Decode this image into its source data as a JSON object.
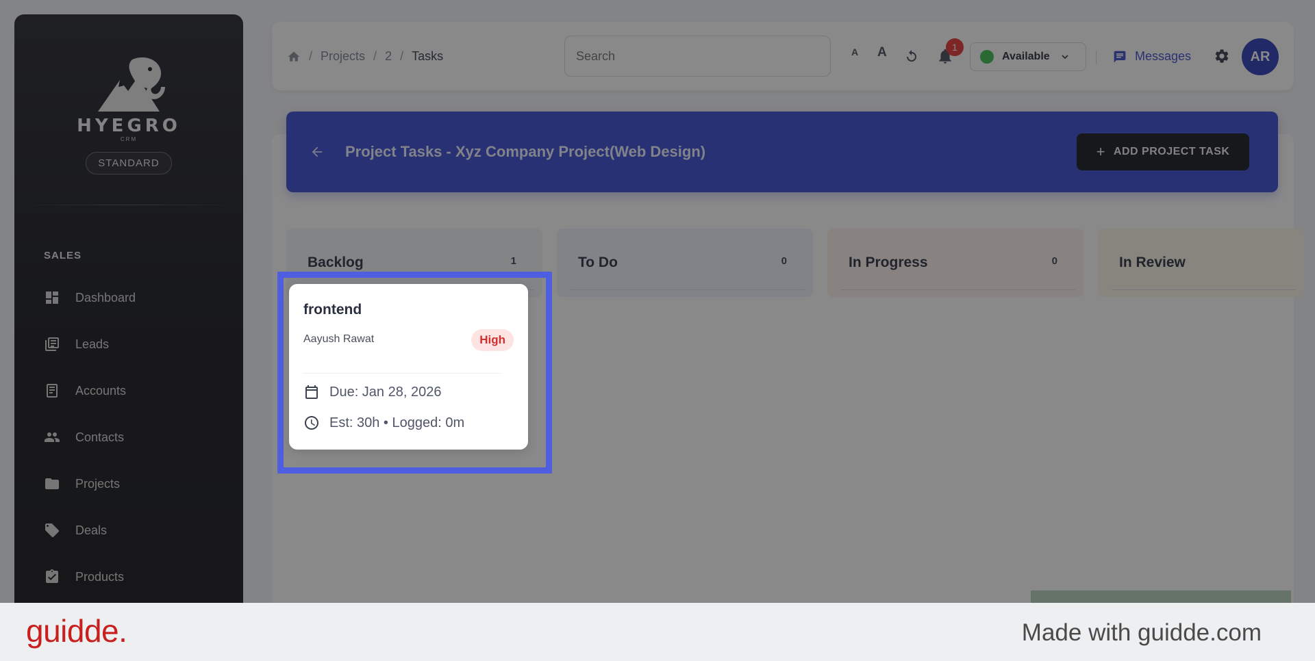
{
  "sidebar": {
    "brand": "HYEGRO",
    "brand_sub": "CRM",
    "plan": "STANDARD",
    "section": "SALES",
    "items": [
      {
        "label": "Dashboard",
        "icon": "dashboard-icon"
      },
      {
        "label": "Leads",
        "icon": "leads-icon"
      },
      {
        "label": "Accounts",
        "icon": "accounts-icon"
      },
      {
        "label": "Contacts",
        "icon": "contacts-icon"
      },
      {
        "label": "Projects",
        "icon": "folder-icon"
      },
      {
        "label": "Deals",
        "icon": "tag-icon"
      },
      {
        "label": "Products",
        "icon": "clipboard-icon"
      }
    ]
  },
  "topbar": {
    "breadcrumb": [
      "Projects",
      "2",
      "Tasks"
    ],
    "search_placeholder": "Search",
    "font_small": "A",
    "font_large": "A",
    "notifications_count": "1",
    "status": "Available",
    "status_color": "#3cbf52",
    "messages": "Messages",
    "avatar_initials": "AR"
  },
  "header": {
    "title": "Project Tasks - Xyz Company Project(Web Design)",
    "add_button": "ADD PROJECT TASK"
  },
  "columns": [
    {
      "title": "Backlog",
      "count": "1"
    },
    {
      "title": "To Do",
      "count": "0"
    },
    {
      "title": "In Progress",
      "count": "0"
    },
    {
      "title": "In Review",
      "count": ""
    }
  ],
  "card": {
    "title": "frontend",
    "assignee": "Aayush Rawat",
    "priority": "High",
    "due": "Due: Jan 28, 2026",
    "estimate": "Est: 30h • Logged: 0m"
  },
  "footer": {
    "brand": "guidde.",
    "made_with": "Made with guidde.com"
  },
  "colors": {
    "accent": "#3a4fd0",
    "highlight": "#4f5de0",
    "priority_high": "#d32f2f"
  }
}
